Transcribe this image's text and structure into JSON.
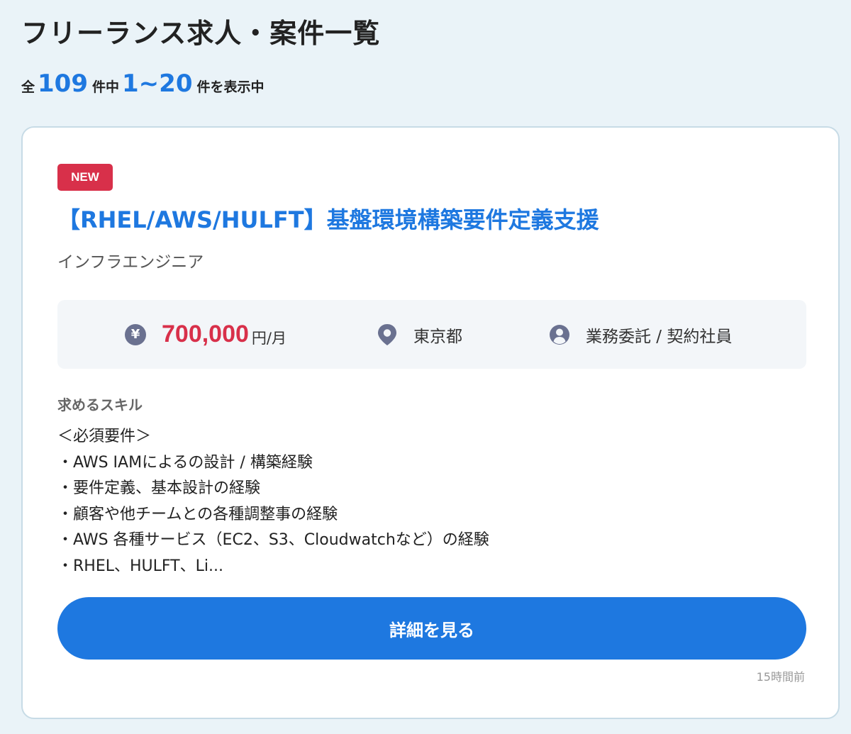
{
  "page": {
    "title": "フリーランス求人・案件一覧"
  },
  "results": {
    "prefix": "全",
    "total": "109",
    "mid": "件中",
    "range": "1~20",
    "suffix": "件を表示中"
  },
  "job": {
    "badge": "NEW",
    "title": "【RHEL/AWS/HULFT】基盤環境構築要件定義支援",
    "category": "インフラエンジニア",
    "salary_icon": "¥",
    "salary_value": "700,000",
    "salary_unit": "円/月",
    "location": "東京都",
    "contract_type": "業務委託 / 契約社員",
    "skills_heading": "求めるスキル",
    "skills_lines": [
      "＜必須要件＞",
      "・AWS IAMによるの設計 / 構築経験",
      "・要件定義、基本設計の経験",
      "・顧客や他チームとの各種調整事の経験",
      "・AWS 各種サービス（EC2、S3、Cloudwatchなど）の経験",
      "・RHEL、HULFT、Li..."
    ],
    "button_label": "詳細を見る",
    "posted_time": "15時間前"
  },
  "icons": {
    "salary": "yen-icon",
    "location": "location-pin-icon",
    "contract": "person-icon"
  },
  "colors": {
    "accent": "#1e78e0",
    "badge": "#d8304a",
    "salary": "#d8304a",
    "icon": "#6a7190",
    "background": "#eaf3f8"
  }
}
